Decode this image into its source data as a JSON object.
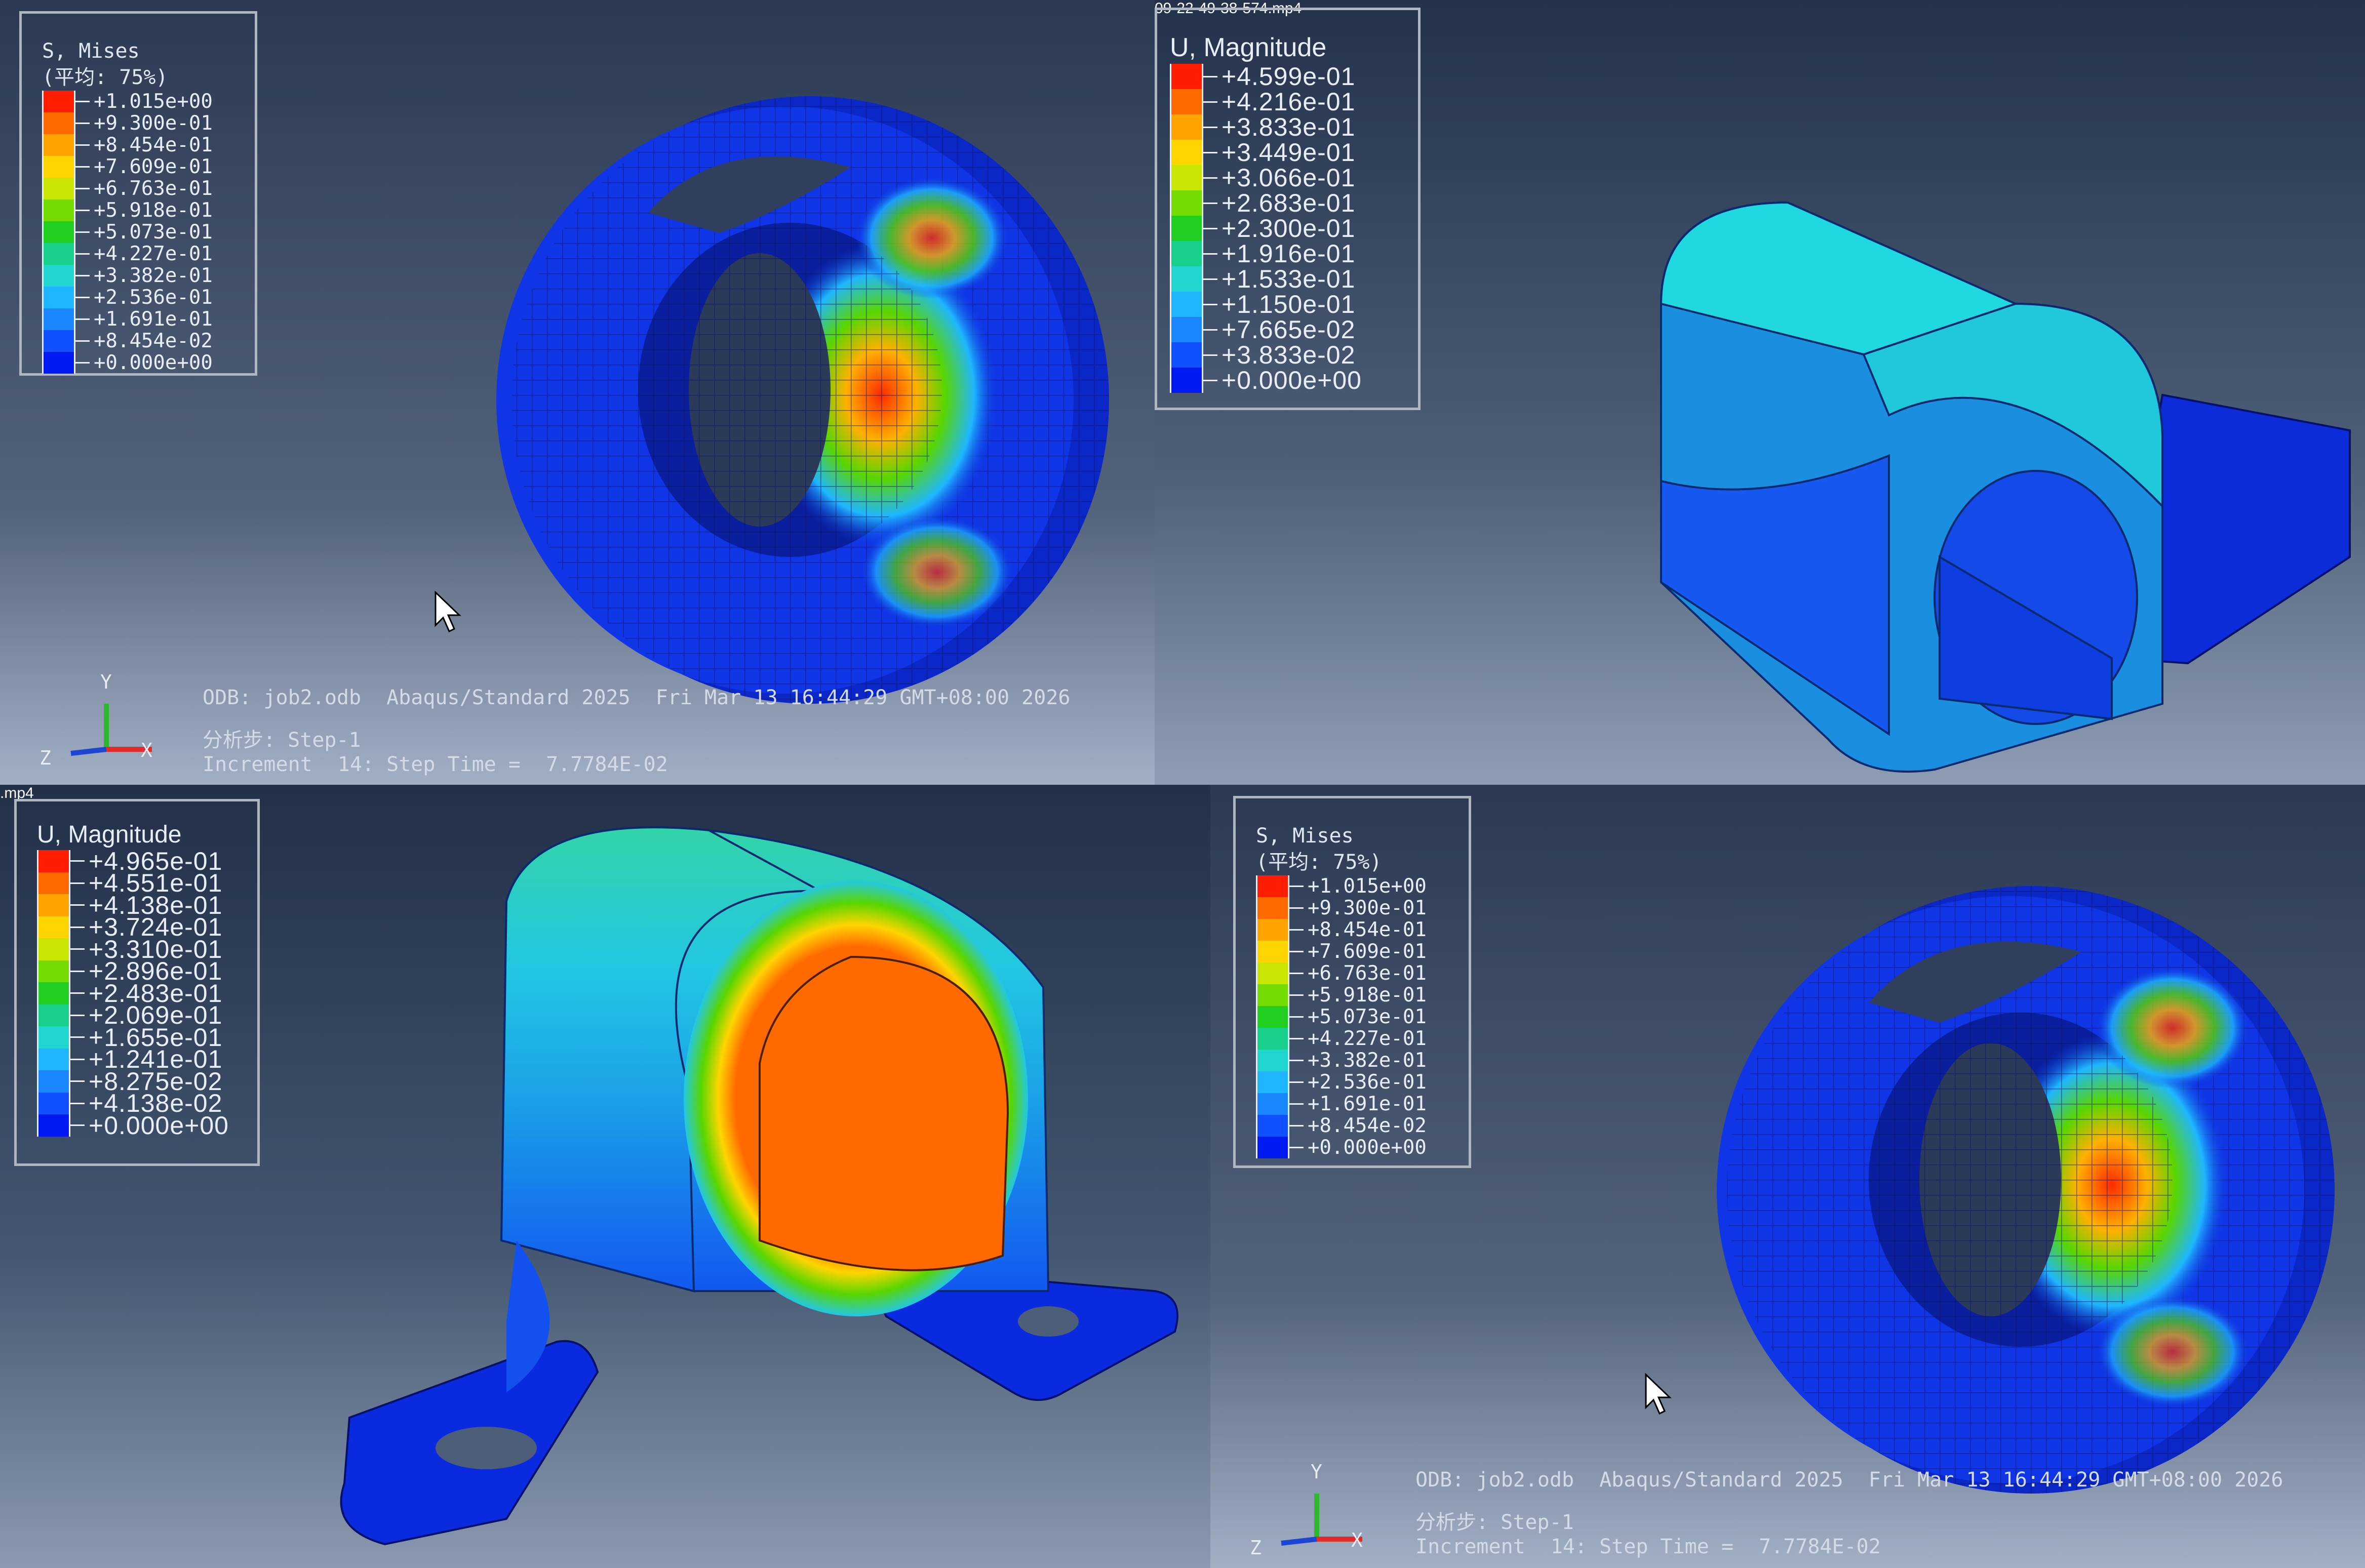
{
  "colors": {
    "viewport_top": "#2b3a52",
    "viewport_bottom": "#8d9cb3",
    "legend_border": "#aeb6c2",
    "scale": [
      "#ff1c00",
      "#ff6a00",
      "#ffa300",
      "#ffd500",
      "#c8e600",
      "#74dc00",
      "#20cf20",
      "#18d08c",
      "#22d6d0",
      "#1fb6ff",
      "#1a86ff",
      "#1150ff",
      "#0019f0"
    ]
  },
  "panels": {
    "top_left": {
      "legend": {
        "title": "S, Mises",
        "subtitle": "(平均: 75%)",
        "values": [
          "+1.015e+00",
          "+9.300e-01",
          "+8.454e-01",
          "+7.609e-01",
          "+6.763e-01",
          "+5.918e-01",
          "+5.073e-01",
          "+4.227e-01",
          "+3.382e-01",
          "+2.536e-01",
          "+1.691e-01",
          "+8.454e-02",
          "+0.000e+00"
        ]
      },
      "info": {
        "odb": "ODB: job2.odb",
        "solver": "Abaqus/Standard 2025",
        "date": "Fri Mar 13 16:44:29 GMT+08:00 2026",
        "step": "分析步: Step-1",
        "increment": "Increment",
        "step_time": "14: Step Time =",
        "step_time_value": "7.7784E-02"
      },
      "triad": {
        "x": "X",
        "y": "Y",
        "z": "Z"
      },
      "cursor_icon": "mouse-pointer-icon"
    },
    "top_right": {
      "file_tag": "09-22-49-38-574.mp4",
      "legend": {
        "title": "U, Magnitude",
        "values": [
          "+4.599e-01",
          "+4.216e-01",
          "+3.833e-01",
          "+3.449e-01",
          "+3.066e-01",
          "+2.683e-01",
          "+2.300e-01",
          "+1.916e-01",
          "+1.533e-01",
          "+1.150e-01",
          "+7.665e-02",
          "+3.833e-02",
          "+0.000e+00"
        ]
      }
    },
    "bottom_left": {
      "file_tag": ".mp4",
      "legend": {
        "title": "U, Magnitude",
        "values": [
          "+4.965e-01",
          "+4.551e-01",
          "+4.138e-01",
          "+3.724e-01",
          "+3.310e-01",
          "+2.896e-01",
          "+2.483e-01",
          "+2.069e-01",
          "+1.655e-01",
          "+1.241e-01",
          "+8.275e-02",
          "+4.138e-02",
          "+0.000e+00"
        ]
      }
    },
    "bottom_right": {
      "legend": {
        "title": "S, Mises",
        "subtitle": "(平均: 75%)",
        "values": [
          "+1.015e+00",
          "+9.300e-01",
          "+8.454e-01",
          "+7.609e-01",
          "+6.763e-01",
          "+5.918e-01",
          "+5.073e-01",
          "+4.227e-01",
          "+3.382e-01",
          "+2.536e-01",
          "+1.691e-01",
          "+8.454e-02",
          "+0.000e+00"
        ]
      },
      "info": {
        "odb": "ODB: job2.odb",
        "solver": "Abaqus/Standard 2025",
        "date": "Fri Mar 13 16:44:29 GMT+08:00 2026",
        "step": "分析步: Step-1",
        "increment": "Increment",
        "step_time": "14: Step Time =",
        "step_time_value": "7.7784E-02"
      },
      "triad": {
        "x": "X",
        "y": "Y",
        "z": "Z"
      },
      "cursor_icon": "mouse-pointer-icon"
    }
  }
}
